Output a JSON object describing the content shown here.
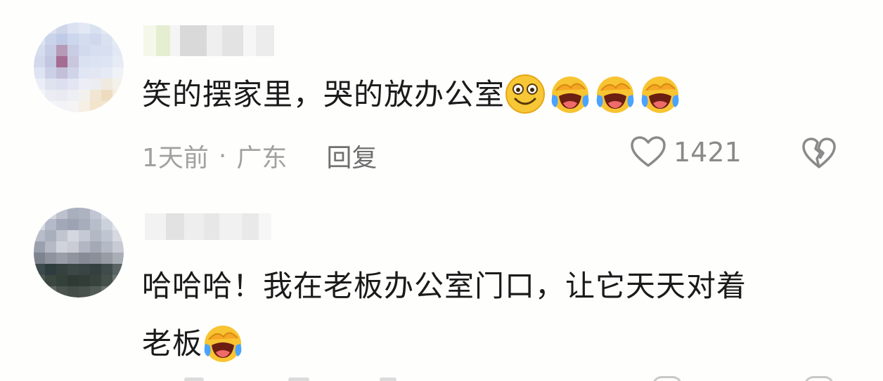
{
  "comments": [
    {
      "text_parts": [
        "笑的摆家里，哭的放办公室"
      ],
      "emojis": [
        "smile-emoji",
        "laugh-cry-emoji",
        "laugh-cry-emoji",
        "laugh-cry-emoji"
      ],
      "time": "1天前",
      "separator": "·",
      "location": "广东",
      "reply_label": "回复",
      "like_count": "1421"
    },
    {
      "text_line1": "哈哈哈！我在老板办公室门口，让它天天对着",
      "text_line2": "老板",
      "emojis": [
        "laugh-cry-emoji"
      ]
    }
  ]
}
